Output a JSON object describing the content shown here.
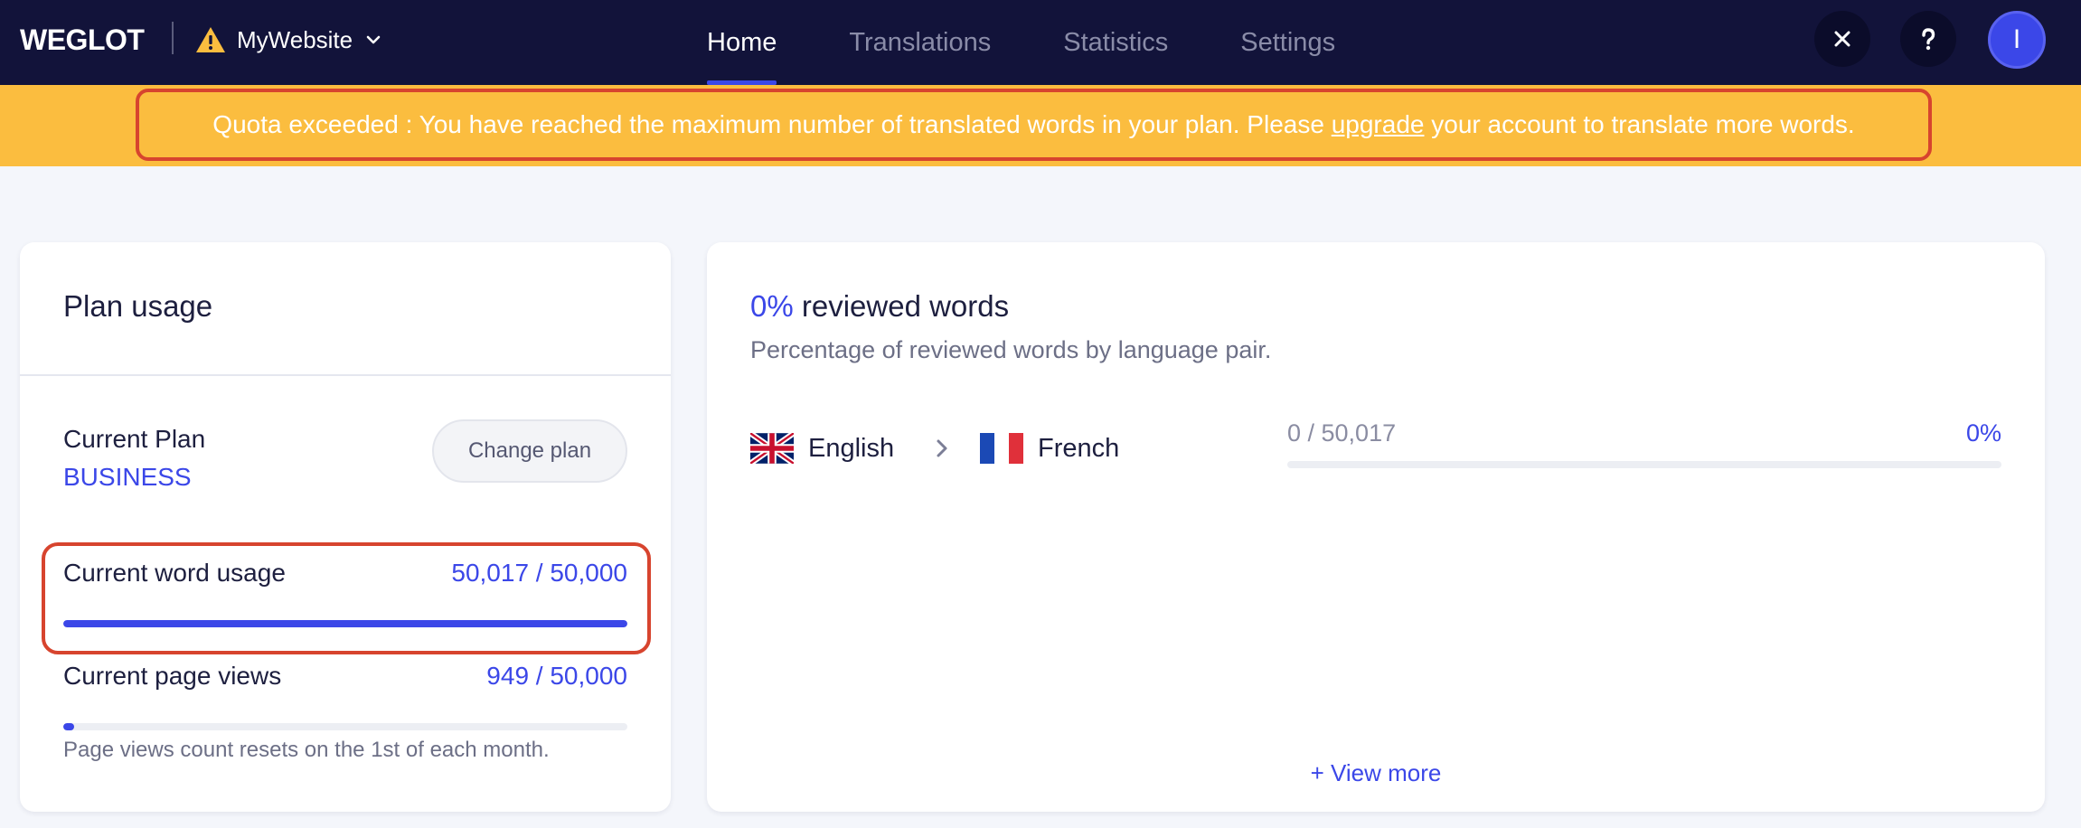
{
  "nav": {
    "brand": "WEGLOT",
    "site_name": "MyWebsite",
    "tabs": [
      {
        "label": "Home",
        "active": true
      },
      {
        "label": "Translations",
        "active": false
      },
      {
        "label": "Statistics",
        "active": false
      },
      {
        "label": "Settings",
        "active": false
      }
    ],
    "avatar_initial": "I",
    "icons": [
      "warning-icon",
      "chevron-down-icon",
      "close-icon",
      "help-icon"
    ]
  },
  "banner": {
    "text_before": "Quota exceeded : You have reached the maximum number of translated words in your plan. Please ",
    "link_text": "upgrade",
    "text_after": " your account to translate more words."
  },
  "plan_usage": {
    "title": "Plan usage",
    "current_plan_label": "Current Plan",
    "current_plan_value": "BUSINESS",
    "change_plan_label": "Change plan",
    "word_usage_label": "Current word usage",
    "word_usage_value": "50,017 / 50,000",
    "word_usage_fraction": 1.0,
    "page_views_label": "Current page views",
    "page_views_value": "949 / 50,000",
    "page_views_fraction": 0.019,
    "page_views_note": "Page views count resets on the 1st of each month."
  },
  "review": {
    "title_pct": "0%",
    "title_text": " reviewed words",
    "subtitle": "Percentage of reviewed words by language pair.",
    "pairs": [
      {
        "source": "English",
        "target": "French",
        "count": "0 / 50,017",
        "percent": "0%",
        "fraction": 0
      }
    ],
    "view_more": "+ View more"
  },
  "colors": {
    "nav_bg": "#12133a",
    "accent": "#3b47e8",
    "banner_bg": "#fbbd3f",
    "highlight": "#d7442e"
  }
}
